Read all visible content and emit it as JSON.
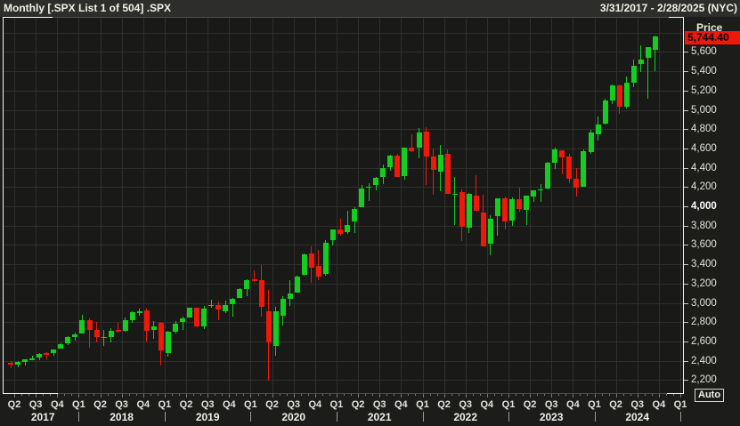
{
  "header": {
    "title": "Monthly [.SPX List 1 of 504] .SPX",
    "date_range": "3/31/2017 - 2/28/2025 (NYC)"
  },
  "y_axis": {
    "title": "Price",
    "auto_label": "Auto",
    "last_price_label": "5,744.40",
    "last_price_bg": "#f01808",
    "ticks": [
      {
        "value": 5600,
        "label": "5,600",
        "bold": false
      },
      {
        "value": 5400,
        "label": "5,400",
        "bold": false
      },
      {
        "value": 5200,
        "label": "5,200",
        "bold": false
      },
      {
        "value": 5000,
        "label": "5,000",
        "bold": false
      },
      {
        "value": 4800,
        "label": "4,800",
        "bold": false
      },
      {
        "value": 4600,
        "label": "4,600",
        "bold": false
      },
      {
        "value": 4400,
        "label": "4,400",
        "bold": false
      },
      {
        "value": 4200,
        "label": "4,200",
        "bold": false
      },
      {
        "value": 4000,
        "label": "4,000",
        "bold": true
      },
      {
        "value": 3800,
        "label": "3,800",
        "bold": false
      },
      {
        "value": 3600,
        "label": "3,600",
        "bold": false
      },
      {
        "value": 3400,
        "label": "3,400",
        "bold": false
      },
      {
        "value": 3200,
        "label": "3,200",
        "bold": false
      },
      {
        "value": 3000,
        "label": "3,000",
        "bold": false
      },
      {
        "value": 2800,
        "label": "2,800",
        "bold": false
      },
      {
        "value": 2600,
        "label": "2,600",
        "bold": false
      },
      {
        "value": 2400,
        "label": "2,400",
        "bold": false
      },
      {
        "value": 2200,
        "label": "2,200",
        "bold": false
      }
    ]
  },
  "x_axis": {
    "quarters": [
      {
        "label": "Q2",
        "i": 1
      },
      {
        "label": "Q3",
        "i": 4
      },
      {
        "label": "Q4",
        "i": 7
      },
      {
        "label": "Q1",
        "i": 10
      },
      {
        "label": "Q2",
        "i": 13
      },
      {
        "label": "Q3",
        "i": 16
      },
      {
        "label": "Q4",
        "i": 19
      },
      {
        "label": "Q1",
        "i": 22
      },
      {
        "label": "Q2",
        "i": 25
      },
      {
        "label": "Q3",
        "i": 28
      },
      {
        "label": "Q4",
        "i": 31
      },
      {
        "label": "Q1",
        "i": 34
      },
      {
        "label": "Q2",
        "i": 37
      },
      {
        "label": "Q3",
        "i": 40
      },
      {
        "label": "Q4",
        "i": 43
      },
      {
        "label": "Q1",
        "i": 46
      },
      {
        "label": "Q2",
        "i": 49
      },
      {
        "label": "Q3",
        "i": 52
      },
      {
        "label": "Q4",
        "i": 55
      },
      {
        "label": "Q1",
        "i": 58
      },
      {
        "label": "Q2",
        "i": 61
      },
      {
        "label": "Q3",
        "i": 64
      },
      {
        "label": "Q4",
        "i": 67
      },
      {
        "label": "Q1",
        "i": 70
      },
      {
        "label": "Q2",
        "i": 73
      },
      {
        "label": "Q3",
        "i": 76
      },
      {
        "label": "Q4",
        "i": 79
      },
      {
        "label": "Q1",
        "i": 82
      },
      {
        "label": "Q2",
        "i": 85
      },
      {
        "label": "Q3",
        "i": 88
      },
      {
        "label": "Q4",
        "i": 91
      },
      {
        "label": "Q1",
        "i": 94
      }
    ],
    "years": [
      {
        "label": "2017",
        "from": 0,
        "to": 10
      },
      {
        "label": "2018",
        "from": 10,
        "to": 22
      },
      {
        "label": "2019",
        "from": 22,
        "to": 34
      },
      {
        "label": "2020",
        "from": 34,
        "to": 46
      },
      {
        "label": "2021",
        "from": 46,
        "to": 58
      },
      {
        "label": "2022",
        "from": 58,
        "to": 70
      },
      {
        "label": "2023",
        "from": 70,
        "to": 82
      },
      {
        "label": "2024",
        "from": 82,
        "to": 94
      }
    ]
  },
  "chart_data": {
    "type": "candlestick",
    "symbol": ".SPX",
    "interval": "Monthly",
    "title": "Monthly [.SPX List 1 of 504] .SPX",
    "period": "3/31/2017 - 2/28/2025 (NYC)",
    "last_price": 5744.4,
    "ylim": [
      2055,
      5963
    ],
    "grid_step": 200,
    "up_color": "#15cd21",
    "down_color": "#f01808",
    "legend_position": "none",
    "months": [
      {
        "m": "2017-03",
        "o": 2380.1,
        "h": 2401.0,
        "l": 2322.3,
        "c": 2362.7
      },
      {
        "m": "2017-04",
        "o": 2362.3,
        "h": 2398.2,
        "l": 2329.0,
        "c": 2384.2
      },
      {
        "m": "2017-05",
        "o": 2388.5,
        "h": 2418.7,
        "l": 2352.7,
        "c": 2411.8
      },
      {
        "m": "2017-06",
        "o": 2415.7,
        "h": 2453.8,
        "l": 2405.7,
        "c": 2423.4
      },
      {
        "m": "2017-07",
        "o": 2431.4,
        "h": 2484.0,
        "l": 2407.7,
        "c": 2470.3
      },
      {
        "m": "2017-08",
        "o": 2477.1,
        "h": 2490.9,
        "l": 2417.4,
        "c": 2471.7
      },
      {
        "m": "2017-09",
        "o": 2474.4,
        "h": 2519.4,
        "l": 2446.6,
        "c": 2519.4
      },
      {
        "m": "2017-10",
        "o": 2521.2,
        "h": 2583.0,
        "l": 2520.4,
        "c": 2575.3
      },
      {
        "m": "2017-11",
        "o": 2583.2,
        "h": 2657.7,
        "l": 2557.5,
        "c": 2647.6
      },
      {
        "m": "2017-12",
        "o": 2645.1,
        "h": 2695.0,
        "l": 2605.5,
        "c": 2673.6
      },
      {
        "m": "2018-01",
        "o": 2683.7,
        "h": 2872.9,
        "l": 2682.4,
        "c": 2823.8
      },
      {
        "m": "2018-02",
        "o": 2816.4,
        "h": 2836.0,
        "l": 2532.7,
        "c": 2713.8
      },
      {
        "m": "2018-03",
        "o": 2715.2,
        "h": 2801.9,
        "l": 2585.9,
        "c": 2640.9
      },
      {
        "m": "2018-04",
        "o": 2633.4,
        "h": 2717.5,
        "l": 2553.8,
        "c": 2648.1
      },
      {
        "m": "2018-05",
        "o": 2643.0,
        "h": 2742.1,
        "l": 2594.6,
        "c": 2705.3
      },
      {
        "m": "2018-06",
        "o": 2718.7,
        "h": 2791.5,
        "l": 2692.0,
        "c": 2718.4
      },
      {
        "m": "2018-07",
        "o": 2704.9,
        "h": 2848.0,
        "l": 2699.0,
        "c": 2816.3
      },
      {
        "m": "2018-08",
        "o": 2821.2,
        "h": 2916.5,
        "l": 2796.3,
        "c": 2901.5
      },
      {
        "m": "2018-09",
        "o": 2897.0,
        "h": 2940.9,
        "l": 2864.1,
        "c": 2914.0
      },
      {
        "m": "2018-10",
        "o": 2926.3,
        "h": 2939.9,
        "l": 2603.5,
        "c": 2711.7
      },
      {
        "m": "2018-11",
        "o": 2717.6,
        "h": 2815.2,
        "l": 2631.1,
        "c": 2760.2
      },
      {
        "m": "2018-12",
        "o": 2790.5,
        "h": 2800.2,
        "l": 2346.6,
        "c": 2506.9
      },
      {
        "m": "2019-01",
        "o": 2477.0,
        "h": 2709.0,
        "l": 2444.0,
        "c": 2704.1
      },
      {
        "m": "2019-02",
        "o": 2702.3,
        "h": 2813.5,
        "l": 2681.8,
        "c": 2784.5
      },
      {
        "m": "2019-03",
        "o": 2798.2,
        "h": 2860.3,
        "l": 2722.3,
        "c": 2834.4
      },
      {
        "m": "2019-04",
        "o": 2848.6,
        "h": 2949.5,
        "l": 2848.6,
        "c": 2945.8
      },
      {
        "m": "2019-05",
        "o": 2952.3,
        "h": 2954.1,
        "l": 2750.5,
        "c": 2752.1
      },
      {
        "m": "2019-06",
        "o": 2751.5,
        "h": 2964.1,
        "l": 2728.8,
        "c": 2941.8
      },
      {
        "m": "2019-07",
        "o": 2971.4,
        "h": 3028.0,
        "l": 2945.1,
        "c": 2980.4
      },
      {
        "m": "2019-08",
        "o": 2980.3,
        "h": 3013.6,
        "l": 2822.1,
        "c": 2926.5
      },
      {
        "m": "2019-09",
        "o": 2909.0,
        "h": 3022.0,
        "l": 2891.9,
        "c": 2976.7
      },
      {
        "m": "2019-10",
        "o": 2983.7,
        "h": 3050.1,
        "l": 2855.9,
        "c": 3037.6
      },
      {
        "m": "2019-11",
        "o": 3050.7,
        "h": 3154.3,
        "l": 3050.7,
        "c": 3141.0
      },
      {
        "m": "2019-12",
        "o": 3143.9,
        "h": 3247.9,
        "l": 3070.3,
        "c": 3230.8
      },
      {
        "m": "2020-01",
        "o": 3244.7,
        "h": 3337.8,
        "l": 3214.6,
        "c": 3225.5
      },
      {
        "m": "2020-02",
        "o": 3235.7,
        "h": 3393.5,
        "l": 2855.8,
        "c": 2954.2
      },
      {
        "m": "2020-03",
        "o": 2910.0,
        "h": 3136.7,
        "l": 2191.9,
        "c": 2584.6
      },
      {
        "m": "2020-04",
        "o": 2558.0,
        "h": 2954.9,
        "l": 2447.5,
        "c": 2912.4
      },
      {
        "m": "2020-05",
        "o": 2869.1,
        "h": 3068.7,
        "l": 2766.6,
        "c": 3044.3
      },
      {
        "m": "2020-06",
        "o": 3038.8,
        "h": 3233.1,
        "l": 2965.7,
        "c": 3100.3
      },
      {
        "m": "2020-07",
        "o": 3105.9,
        "h": 3280.0,
        "l": 3101.2,
        "c": 3271.1
      },
      {
        "m": "2020-08",
        "o": 3288.3,
        "h": 3514.8,
        "l": 3284.5,
        "c": 3500.3
      },
      {
        "m": "2020-09",
        "o": 3507.4,
        "h": 3588.1,
        "l": 3209.5,
        "c": 3363.0
      },
      {
        "m": "2020-10",
        "o": 3385.9,
        "h": 3549.9,
        "l": 3233.9,
        "c": 3270.0
      },
      {
        "m": "2020-11",
        "o": 3296.2,
        "h": 3646.0,
        "l": 3279.7,
        "c": 3621.6
      },
      {
        "m": "2020-12",
        "o": 3645.9,
        "h": 3760.2,
        "l": 3596.0,
        "c": 3756.1
      },
      {
        "m": "2021-01",
        "o": 3764.6,
        "h": 3870.9,
        "l": 3694.1,
        "c": 3714.2
      },
      {
        "m": "2021-02",
        "o": 3731.2,
        "h": 3950.4,
        "l": 3713.2,
        "c": 3811.2
      },
      {
        "m": "2021-03",
        "o": 3842.5,
        "h": 3994.4,
        "l": 3723.3,
        "c": 3972.9
      },
      {
        "m": "2021-04",
        "o": 3992.8,
        "h": 4218.8,
        "l": 3992.8,
        "c": 4181.2
      },
      {
        "m": "2021-05",
        "o": 4192.0,
        "h": 4238.0,
        "l": 4056.9,
        "c": 4204.1
      },
      {
        "m": "2021-06",
        "o": 4216.5,
        "h": 4302.4,
        "l": 4164.4,
        "c": 4297.5
      },
      {
        "m": "2021-07",
        "o": 4300.7,
        "h": 4430.0,
        "l": 4233.1,
        "c": 4395.3
      },
      {
        "m": "2021-08",
        "o": 4406.9,
        "h": 4537.4,
        "l": 4367.7,
        "c": 4522.7
      },
      {
        "m": "2021-09",
        "o": 4528.8,
        "h": 4545.9,
        "l": 4305.9,
        "c": 4307.5
      },
      {
        "m": "2021-10",
        "o": 4317.2,
        "h": 4608.1,
        "l": 4278.9,
        "c": 4605.4
      },
      {
        "m": "2021-11",
        "o": 4610.6,
        "h": 4743.8,
        "l": 4560.0,
        "c": 4567.0
      },
      {
        "m": "2021-12",
        "o": 4602.8,
        "h": 4808.9,
        "l": 4495.1,
        "c": 4766.2
      },
      {
        "m": "2022-01",
        "o": 4778.1,
        "h": 4818.6,
        "l": 4222.6,
        "c": 4515.6
      },
      {
        "m": "2022-02",
        "o": 4519.6,
        "h": 4595.3,
        "l": 4114.7,
        "c": 4373.9
      },
      {
        "m": "2022-03",
        "o": 4363.1,
        "h": 4637.3,
        "l": 4157.9,
        "c": 4530.4
      },
      {
        "m": "2022-04",
        "o": 4540.3,
        "h": 4593.5,
        "l": 4124.3,
        "c": 4131.9
      },
      {
        "m": "2022-05",
        "o": 4130.6,
        "h": 4307.7,
        "l": 3810.3,
        "c": 4132.2
      },
      {
        "m": "2022-06",
        "o": 4149.8,
        "h": 4177.5,
        "l": 3636.9,
        "c": 3785.4
      },
      {
        "m": "2022-07",
        "o": 3781.0,
        "h": 4140.2,
        "l": 3721.6,
        "c": 4130.3
      },
      {
        "m": "2022-08",
        "o": 4112.4,
        "h": 4325.3,
        "l": 3954.5,
        "c": 3955.0
      },
      {
        "m": "2022-09",
        "o": 3936.7,
        "h": 4119.3,
        "l": 3584.1,
        "c": 3585.6
      },
      {
        "m": "2022-10",
        "o": 3609.8,
        "h": 3905.4,
        "l": 3491.6,
        "c": 3872.0
      },
      {
        "m": "2022-11",
        "o": 3901.8,
        "h": 4080.1,
        "l": 3698.2,
        "c": 4080.1
      },
      {
        "m": "2022-12",
        "o": 4087.1,
        "h": 4100.5,
        "l": 3764.5,
        "c": 3839.5
      },
      {
        "m": "2023-01",
        "o": 3853.3,
        "h": 4094.2,
        "l": 3794.3,
        "c": 4076.6
      },
      {
        "m": "2023-02",
        "o": 4070.1,
        "h": 4195.4,
        "l": 3943.1,
        "c": 3970.2
      },
      {
        "m": "2023-03",
        "o": 3963.3,
        "h": 4110.8,
        "l": 3808.9,
        "c": 4109.3
      },
      {
        "m": "2023-04",
        "o": 4102.2,
        "h": 4170.1,
        "l": 4049.4,
        "c": 4169.5
      },
      {
        "m": "2023-05",
        "o": 4166.8,
        "h": 4231.1,
        "l": 4048.3,
        "c": 4179.8
      },
      {
        "m": "2023-06",
        "o": 4183.0,
        "h": 4458.5,
        "l": 4171.6,
        "c": 4450.4
      },
      {
        "m": "2023-07",
        "o": 4450.5,
        "h": 4607.1,
        "l": 4385.1,
        "c": 4589.0
      },
      {
        "m": "2023-08",
        "o": 4578.8,
        "h": 4584.6,
        "l": 4335.3,
        "c": 4507.7
      },
      {
        "m": "2023-09",
        "o": 4517.0,
        "h": 4541.3,
        "l": 4238.6,
        "c": 4288.1
      },
      {
        "m": "2023-10",
        "o": 4284.5,
        "h": 4393.6,
        "l": 4103.8,
        "c": 4193.8
      },
      {
        "m": "2023-11",
        "o": 4201.3,
        "h": 4587.6,
        "l": 4197.7,
        "c": 4567.8
      },
      {
        "m": "2023-12",
        "o": 4559.4,
        "h": 4793.3,
        "l": 4546.5,
        "c": 4769.8
      },
      {
        "m": "2024-01",
        "o": 4745.2,
        "h": 4931.1,
        "l": 4682.1,
        "c": 4845.7
      },
      {
        "m": "2024-02",
        "o": 4861.1,
        "h": 5111.1,
        "l": 4845.2,
        "c": 5096.3
      },
      {
        "m": "2024-03",
        "o": 5098.5,
        "h": 5264.9,
        "l": 5056.8,
        "c": 5254.4
      },
      {
        "m": "2024-04",
        "o": 5258.0,
        "h": 5264.0,
        "l": 4953.6,
        "c": 5035.7
      },
      {
        "m": "2024-05",
        "o": 5029.0,
        "h": 5341.9,
        "l": 5011.1,
        "c": 5277.5
      },
      {
        "m": "2024-06",
        "o": 5278.2,
        "h": 5523.6,
        "l": 5234.3,
        "c": 5460.5
      },
      {
        "m": "2024-07",
        "o": 5471.1,
        "h": 5669.7,
        "l": 5391.0,
        "c": 5522.3
      },
      {
        "m": "2024-08",
        "o": 5537.8,
        "h": 5651.6,
        "l": 5119.3,
        "c": 5648.4
      },
      {
        "m": "2024-09",
        "o": 5623.9,
        "h": 5767.4,
        "l": 5402.6,
        "c": 5762.5
      }
    ]
  }
}
